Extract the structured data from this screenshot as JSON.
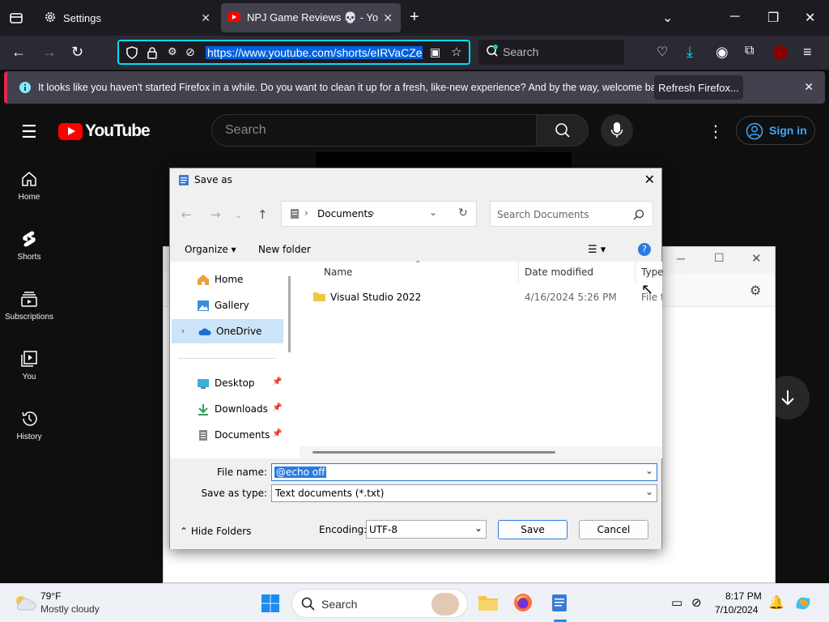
{
  "browser": {
    "tabs": [
      {
        "title": "Settings",
        "active": false
      },
      {
        "title": "NPJ Game Reviews 💀 - YouTube",
        "active": true
      }
    ],
    "url": "https://www.youtube.com/shorts/eIRVaCZe_",
    "search_placeholder": "Search",
    "notification": {
      "text": "It looks like you haven't started Firefox in a while. Do you want to clean it up for a fresh, like-new experience? And by the way, welcome back!",
      "button": "Refresh Firefox..."
    },
    "accent": "#00ddff"
  },
  "youtube": {
    "logo": "YouTube",
    "search_placeholder": "Search",
    "sign_in": "Sign in",
    "sidebar": [
      {
        "label": "Home",
        "icon": "home-icon"
      },
      {
        "label": "Shorts",
        "icon": "shorts-icon"
      },
      {
        "label": "Subscriptions",
        "icon": "subscriptions-icon"
      },
      {
        "label": "You",
        "icon": "you-icon"
      },
      {
        "label": "History",
        "icon": "history-icon"
      }
    ]
  },
  "dialog": {
    "title": "Save as",
    "location": "Documents",
    "search_placeholder": "Search Documents",
    "toolbar": {
      "organize": "Organize",
      "new_folder": "New folder"
    },
    "nav": [
      {
        "label": "Home",
        "pinned": false
      },
      {
        "label": "Gallery",
        "pinned": false
      },
      {
        "label": "OneDrive",
        "pinned": false
      },
      {
        "label": "Desktop",
        "pinned": true
      },
      {
        "label": "Downloads",
        "pinned": true
      },
      {
        "label": "Documents",
        "pinned": true
      }
    ],
    "columns": {
      "name": "Name",
      "date": "Date modified",
      "type": "Type"
    },
    "files": [
      {
        "name": "Visual Studio 2022",
        "date": "4/16/2024 5:26 PM",
        "type": "File fo"
      }
    ],
    "file_name_label": "File name:",
    "file_name_value": "@echo off",
    "save_type_label": "Save as type:",
    "save_type_value": "Text documents (*.txt)",
    "hide_folders": "Hide Folders",
    "encoding_label": "Encoding:",
    "encoding_value": "UTF-8",
    "save": "Save",
    "cancel": "Cancel"
  },
  "taskbar": {
    "weather_temp": "79°F",
    "weather_desc": "Mostly cloudy",
    "search": "Search",
    "time": "8:17 PM",
    "date": "7/10/2024"
  }
}
